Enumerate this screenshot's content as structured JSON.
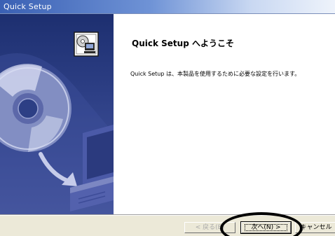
{
  "window": {
    "title": "Quick Setup"
  },
  "content": {
    "heading": "Quick Setup へようこそ",
    "body": "Quick Setup は、本製品を使用するために必要な設定を行います。"
  },
  "buttons": {
    "back_label": "< 戻る(B)",
    "next_label": "次へ(N) >",
    "cancel_label": "キャンセル"
  },
  "colors": {
    "title_bar": "#3a60b4",
    "side_panel": "#2d3f85",
    "dialog_face": "#ece9d8",
    "highlight": "#000000"
  },
  "icons": {
    "setup_icon": "computer-with-disc-icon",
    "side_graphic": "cd-disc-and-computer-illustration"
  }
}
